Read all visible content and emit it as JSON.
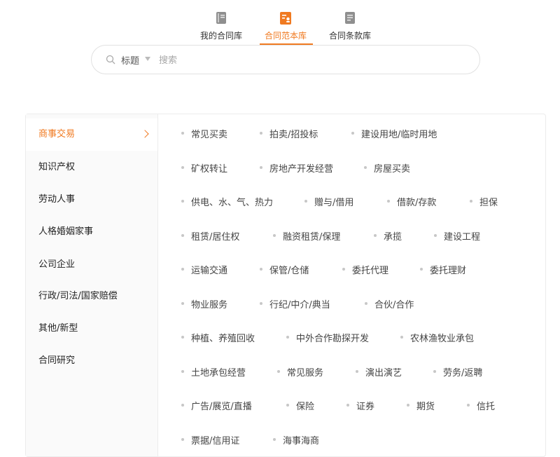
{
  "tabs": [
    {
      "label": "我的合同库",
      "icon": "book-icon",
      "active": false
    },
    {
      "label": "合同范本库",
      "icon": "template-document-icon",
      "active": true
    },
    {
      "label": "合同条款库",
      "icon": "clause-document-icon",
      "active": false
    }
  ],
  "search": {
    "field": "标题",
    "placeholder": "搜索",
    "value": ""
  },
  "sidebar": {
    "items": [
      {
        "label": "商事交易",
        "active": true
      },
      {
        "label": "知识产权"
      },
      {
        "label": "劳动人事"
      },
      {
        "label": "人格婚姻家事"
      },
      {
        "label": "公司企业"
      },
      {
        "label": "行政/司法/国家赔偿"
      },
      {
        "label": "其他/新型"
      },
      {
        "label": "合同研究"
      }
    ]
  },
  "categories": {
    "rows": [
      [
        "常见买卖",
        "拍卖/招投标",
        "建设用地/临时用地"
      ],
      [
        "矿权转让",
        "房地产开发经营",
        "房屋买卖"
      ],
      [
        "供电、水、气、热力",
        "赠与/借用",
        "借款/存款",
        "担保"
      ],
      [
        "租赁/居住权",
        "融资租赁/保理",
        "承揽",
        "建设工程"
      ],
      [
        "运输交通",
        "保管/仓储",
        "委托代理",
        "委托理财"
      ],
      [
        "物业服务",
        "行纪/中介/典当",
        "合伙/合作"
      ],
      [
        "种植、养殖回收",
        "中外合作勘探开发",
        "农林渔牧业承包"
      ],
      [
        "土地承包经营",
        "常见服务",
        "演出演艺",
        "劳务/返聘"
      ],
      [
        "广告/展览/直播",
        "保险",
        "证券",
        "期货",
        "信托"
      ],
      [
        "票据/信用证",
        "海事海商"
      ]
    ]
  },
  "colors": {
    "accent": "#f07a21",
    "icon_gray": "#8a8a8a"
  }
}
